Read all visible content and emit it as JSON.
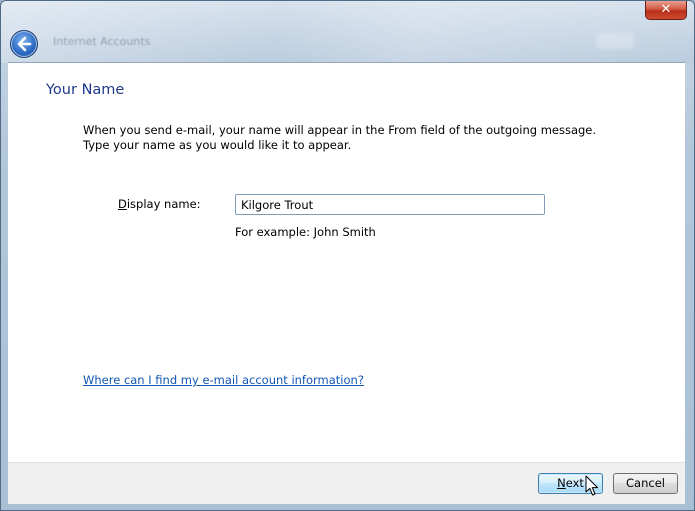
{
  "window": {
    "wizard_title": "Internet Accounts",
    "close_glyph": "✕"
  },
  "page": {
    "heading": "Your Name",
    "description_line1": "When you send e-mail, your name will appear in the From field of the outgoing message.",
    "description_line2": "Type your name as you would like it to appear."
  },
  "form": {
    "display_name_label_access_key": "D",
    "display_name_label_rest": "isplay name:",
    "display_name_value": "Kilgore Trout",
    "example_text": "For example: John Smith"
  },
  "help_link": "Where can I find my e-mail account information?",
  "buttons": {
    "next_access_key": "N",
    "next_rest": "ext",
    "cancel": "Cancel"
  },
  "icons": {
    "back": "back-arrow-icon",
    "close": "close-icon",
    "cursor": "mouse-pointer-icon"
  }
}
